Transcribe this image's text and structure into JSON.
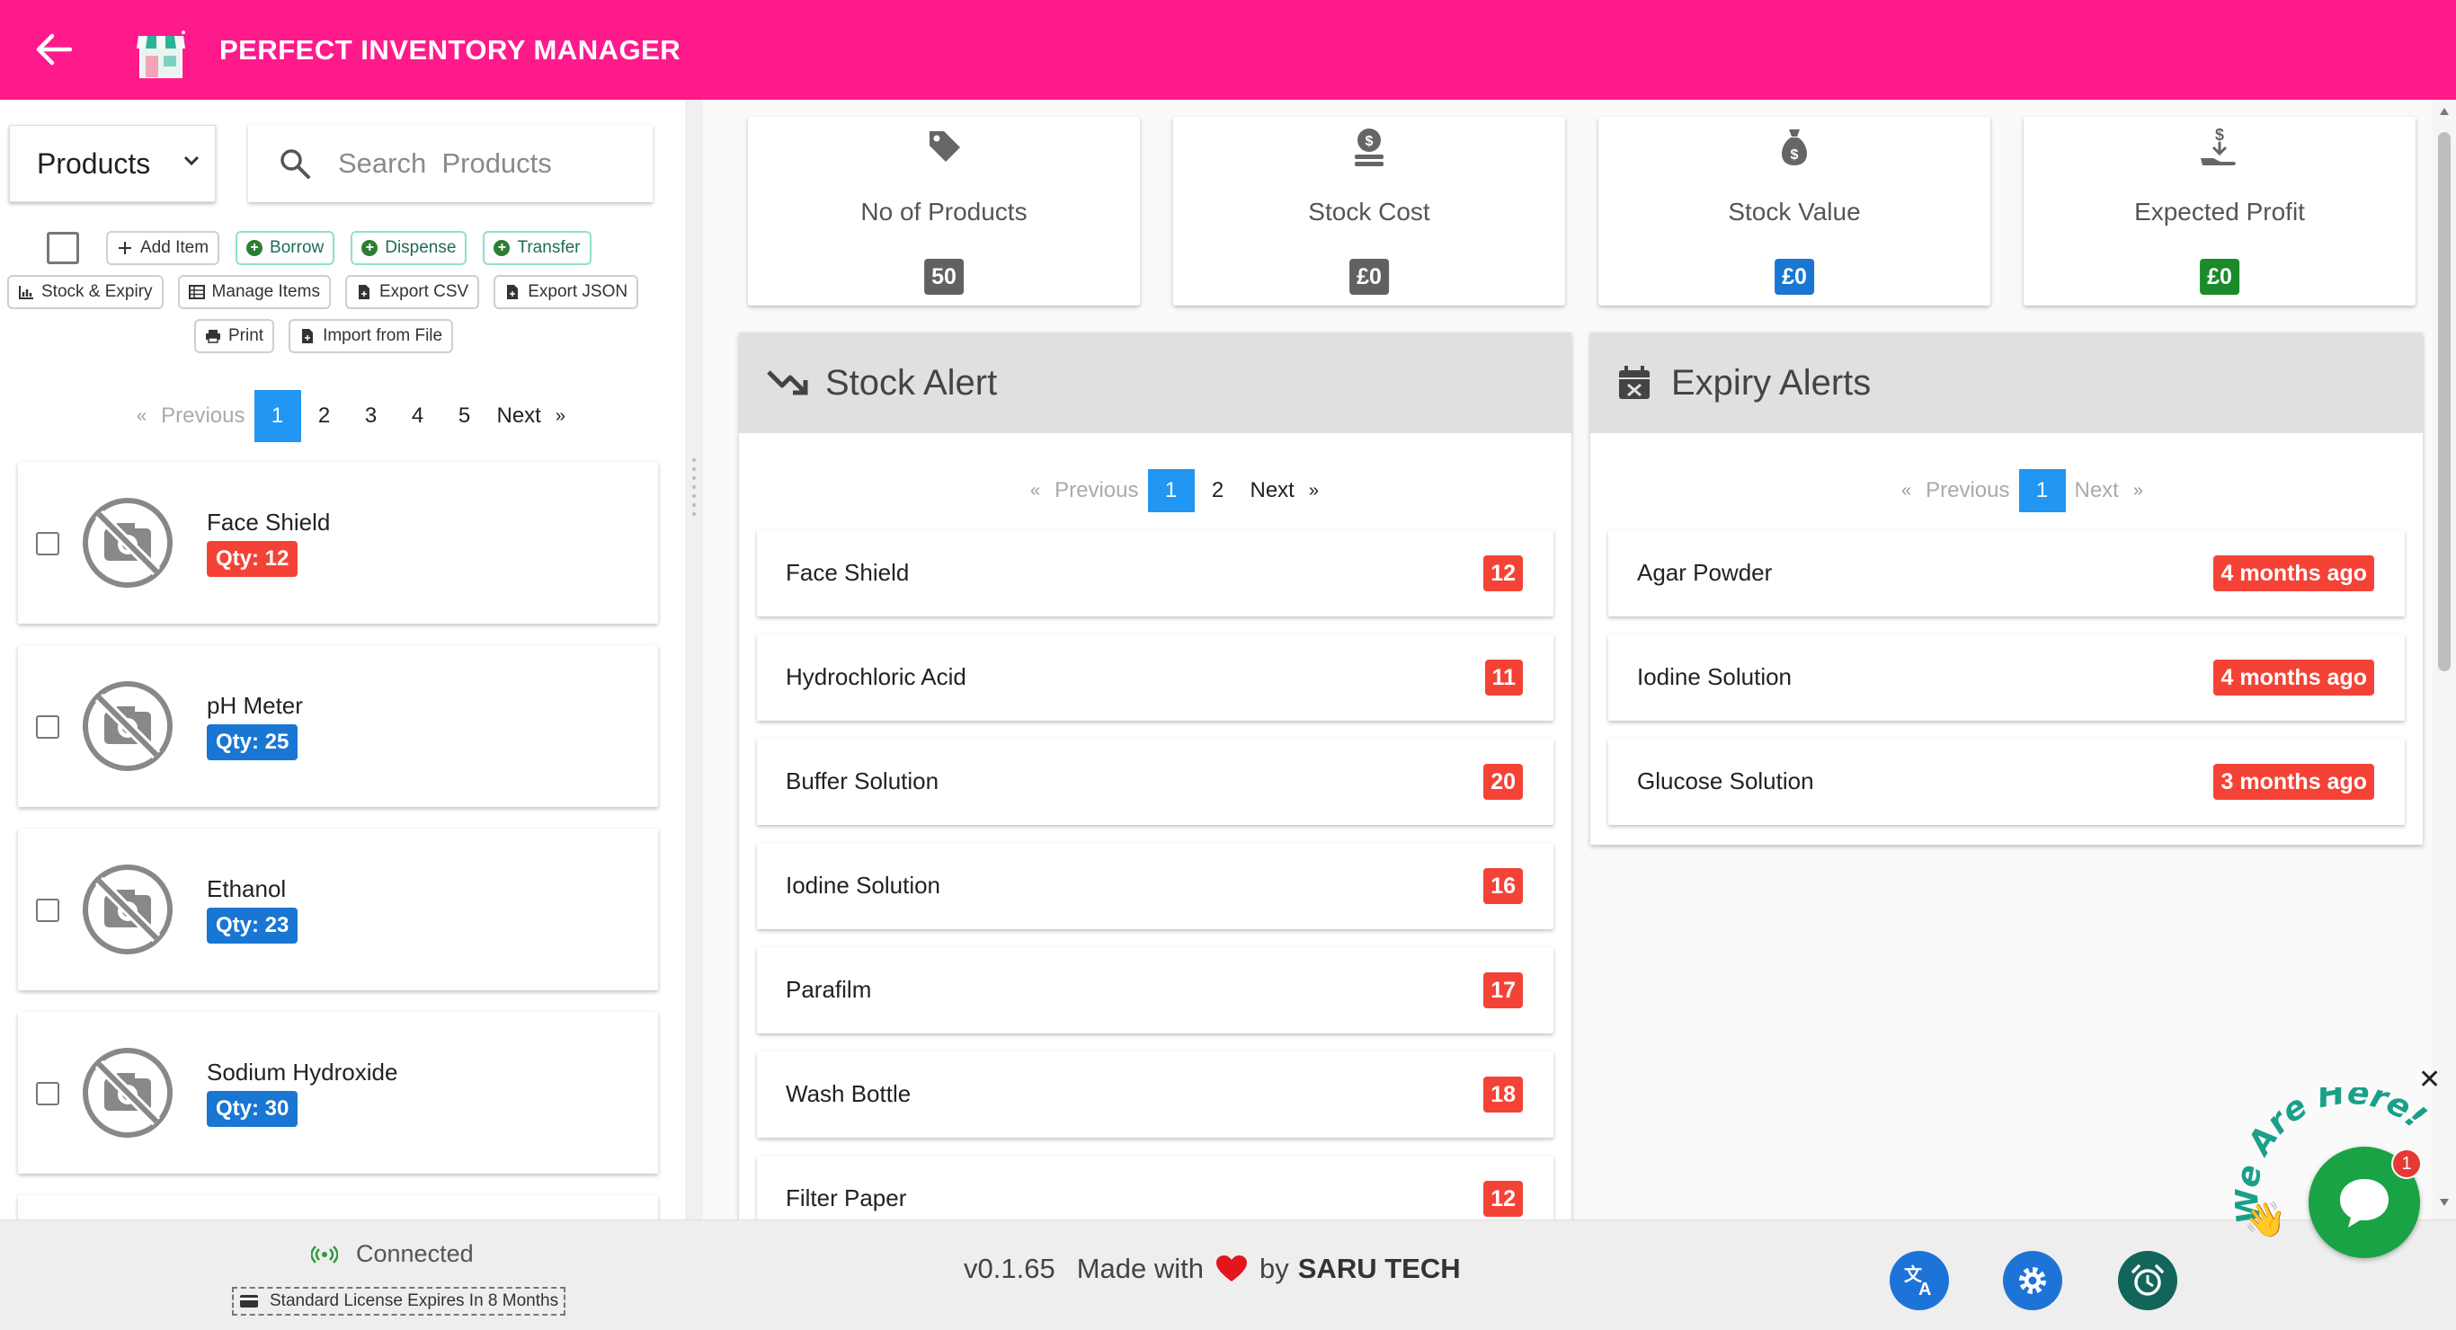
{
  "app": {
    "title": "PERFECT INVENTORY MANAGER"
  },
  "colors": {
    "topbar": "#ff1a8c",
    "blue": "#2196f3",
    "badge_blue": "#1976d2",
    "red": "#f44336",
    "green": "#1b8a2b",
    "grey_badge": "#616161"
  },
  "sidebar": {
    "category_select": "Products",
    "search_placeholder": "Search  Products",
    "toolbar": {
      "add_item": "Add Item",
      "borrow": "Borrow",
      "dispense": "Dispense",
      "transfer": "Transfer",
      "stock_expiry": "Stock & Expiry",
      "manage_items": "Manage Items",
      "export_csv": "Export CSV",
      "export_json": "Export JSON",
      "print": "Print",
      "import_file": "Import from File"
    },
    "pagination": {
      "previous": "Previous",
      "pages": [
        "1",
        "2",
        "3",
        "4",
        "5"
      ],
      "next": "Next"
    },
    "products": [
      {
        "name": "Face Shield",
        "qty": "Qty: 12",
        "qty_color": "red"
      },
      {
        "name": "pH Meter",
        "qty": "Qty: 25",
        "qty_color": "blue"
      },
      {
        "name": "Ethanol",
        "qty": "Qty: 23",
        "qty_color": "blue"
      },
      {
        "name": "Sodium Hydroxide",
        "qty": "Qty: 30",
        "qty_color": "blue"
      }
    ]
  },
  "stats": [
    {
      "label": "No of Products",
      "value": "50",
      "icon": "tag-icon",
      "color": "grey"
    },
    {
      "label": "Stock Cost",
      "value": "£0",
      "icon": "money-stack-icon",
      "color": "grey"
    },
    {
      "label": "Stock Value",
      "value": "£0",
      "icon": "money-bag-icon",
      "color": "blue"
    },
    {
      "label": "Expected Profit",
      "value": "£0",
      "icon": "hand-money-icon",
      "color": "green"
    }
  ],
  "stock_alert": {
    "title": "Stock Alert",
    "pagination": {
      "previous": "Previous",
      "pages": [
        "1",
        "2"
      ],
      "next": "Next"
    },
    "items": [
      {
        "name": "Face Shield",
        "count": "12"
      },
      {
        "name": "Hydrochloric Acid",
        "count": "11"
      },
      {
        "name": "Buffer Solution",
        "count": "20"
      },
      {
        "name": "Iodine Solution",
        "count": "16"
      },
      {
        "name": "Parafilm",
        "count": "17"
      },
      {
        "name": "Wash Bottle",
        "count": "18"
      },
      {
        "name": "Filter Paper",
        "count": "12"
      }
    ]
  },
  "expiry_alerts": {
    "title": "Expiry Alerts",
    "pagination": {
      "previous": "Previous",
      "pages": [
        "1"
      ],
      "next": "Next"
    },
    "items": [
      {
        "name": "Agar Powder",
        "when": "4 months ago"
      },
      {
        "name": "Iodine Solution",
        "when": "4 months ago"
      },
      {
        "name": "Glucose Solution",
        "when": "3 months ago"
      }
    ]
  },
  "status": {
    "connection": "Connected",
    "license": "Standard License Expires In 8 Months",
    "version": "v0.1.65",
    "made_with": "Made with",
    "by": "by",
    "company": "SARU TECH"
  },
  "chat": {
    "caption": "We Are Here!",
    "unread": "1"
  }
}
